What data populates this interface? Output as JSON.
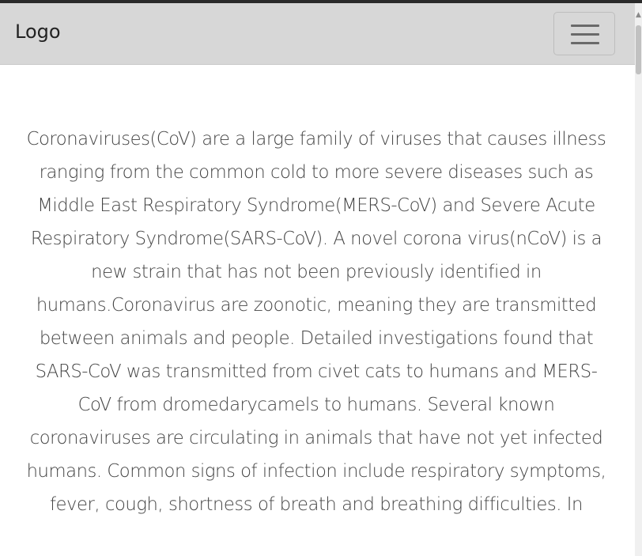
{
  "navbar": {
    "brand": "Logo",
    "toggler_icon": "hamburger-icon"
  },
  "scrollbar": {
    "up_icon": "chevron-up-icon"
  },
  "main": {
    "paragraph": "Coronaviruses(CoV) are a large family of viruses that causes illness ranging from the common cold to more severe diseases such as Middle East Respiratory Syndrome(MERS-CoV) and Severe Acute Respiratory Syndrome(SARS-CoV). A novel corona virus(nCoV) is a new strain that has not been previously identified in humans.Coronavirus are zoonotic, meaning they are transmitted between animals and people. Detailed investigations found that SARS-CoV was transmitted from civet cats to humans and MERS-CoV from dromedarycamels to humans. Several known coronaviruses are circulating in animals that have not yet infected humans. Common signs of infection include respiratory symptoms, fever, cough, shortness of breath and breathing difficulties. In"
  },
  "colors": {
    "navbar_bg": "#d7d7d7",
    "text": "#444444",
    "top_rule": "#2a2a2a"
  }
}
